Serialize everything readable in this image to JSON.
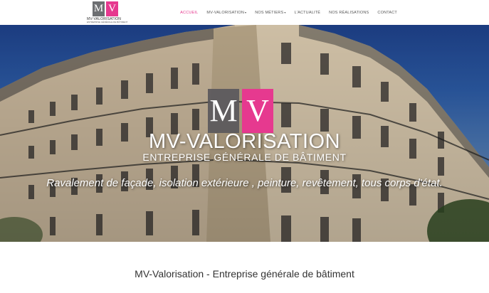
{
  "header": {
    "logo": {
      "letter_m": "M",
      "letter_v": "V",
      "brand": "MV-VALORISATION",
      "tagline": "ENTREPRISE GÉNÉRALE DE BÂTIMENT"
    },
    "nav": [
      {
        "label": "ACCUEIL",
        "active": true,
        "has_dropdown": false
      },
      {
        "label": "MV-VALORISATION",
        "active": false,
        "has_dropdown": true
      },
      {
        "label": "NOS MÉTIERS",
        "active": false,
        "has_dropdown": true
      },
      {
        "label": "L'ACTUALITÉ",
        "active": false,
        "has_dropdown": false
      },
      {
        "label": "NOS RÉALISATIONS",
        "active": false,
        "has_dropdown": false
      },
      {
        "label": "CONTACT",
        "active": false,
        "has_dropdown": false
      }
    ],
    "dropdown_icon": "chevron-down-icon"
  },
  "hero": {
    "letter_m": "M",
    "letter_v": "V",
    "title": "MV-VALORISATION",
    "subtitle": "ENTREPRISE GÉNÉRALE DE BÂTIMENT",
    "tagline": "Ravalement de façade, isolation extérieure , peinture, revêtement, tous corps d'état."
  },
  "main": {
    "heading": "MV-Valorisation - Entreprise générale de bâtiment"
  },
  "colors": {
    "accent": "#e6398f",
    "logo_grey": "#6d6f72",
    "text": "#333333"
  }
}
